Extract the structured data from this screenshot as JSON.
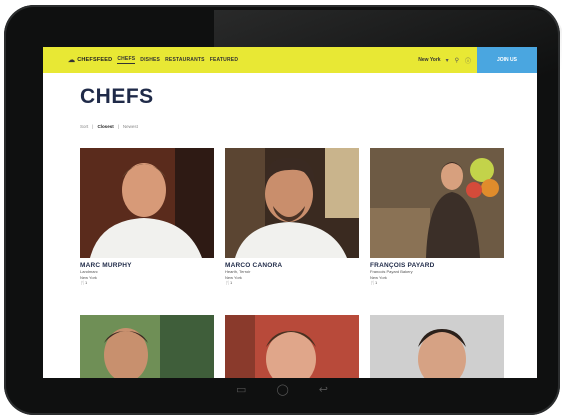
{
  "nav": {
    "logo": "CHEFSFEED",
    "links": [
      "CHEFS",
      "DISHES",
      "RESTAURANTS",
      "FEATURED"
    ],
    "city": "New York",
    "join": "JOIN US"
  },
  "page": {
    "title": "CHEFS",
    "sort_label": "Sort",
    "sort_options": [
      "Closest",
      "Newest"
    ]
  },
  "chefs": [
    {
      "name": "MARC MURPHY",
      "line1": "Landmarc",
      "line2": "New York",
      "count": "1"
    },
    {
      "name": "MARCO CANORA",
      "line1": "Hearth, Terroir",
      "line2": "New York",
      "count": "1"
    },
    {
      "name": "FRANÇOIS PAYARD",
      "line1": "Francois Payard Bakery",
      "line2": "New York",
      "count": "1"
    },
    {
      "name": "",
      "line1": "",
      "line2": "",
      "count": ""
    },
    {
      "name": "",
      "line1": "",
      "line2": "",
      "count": ""
    },
    {
      "name": "",
      "line1": "",
      "line2": "",
      "count": ""
    }
  ],
  "home_bar": [
    "back-icon",
    "home-icon",
    "recent-apps-icon"
  ]
}
